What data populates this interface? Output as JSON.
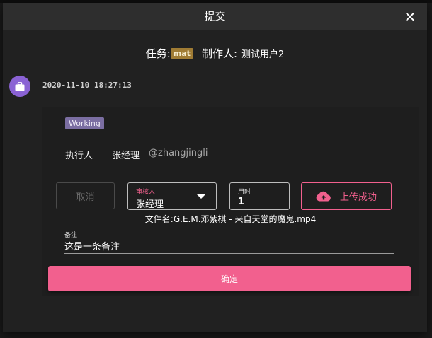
{
  "dialog": {
    "title": "提交"
  },
  "header": {
    "task_label": "任务:",
    "task_badge": "mat",
    "creator_label": "制作人:",
    "creator_value": "测试用户2"
  },
  "entry": {
    "timestamp": "2020-11-10 18:27:13",
    "status": "Working",
    "executor_label": "执行人",
    "executor_name": "张经理",
    "executor_handle": "@zhangjingli"
  },
  "form": {
    "cancel_label": "取消",
    "reviewer_label": "审核人",
    "reviewer_value": "张经理",
    "duration_label": "用时",
    "duration_value": "1",
    "upload_label": "上传成功",
    "filename": "文件名:G.E.M.邓紫棋 - 来自天堂的魔鬼.mp4",
    "note_label": "备注",
    "note_value": "这是一条备注",
    "confirm_label": "确定"
  },
  "colors": {
    "accent": "#f2608e",
    "avatar": "#8a62d4",
    "task_badge": "#a07c34",
    "status_badge": "#7b6ea2"
  },
  "icons": {
    "close": "close-icon",
    "avatar": "briefcase-icon",
    "dropdown": "chevron-down-icon",
    "upload": "cloud-upload-icon"
  }
}
